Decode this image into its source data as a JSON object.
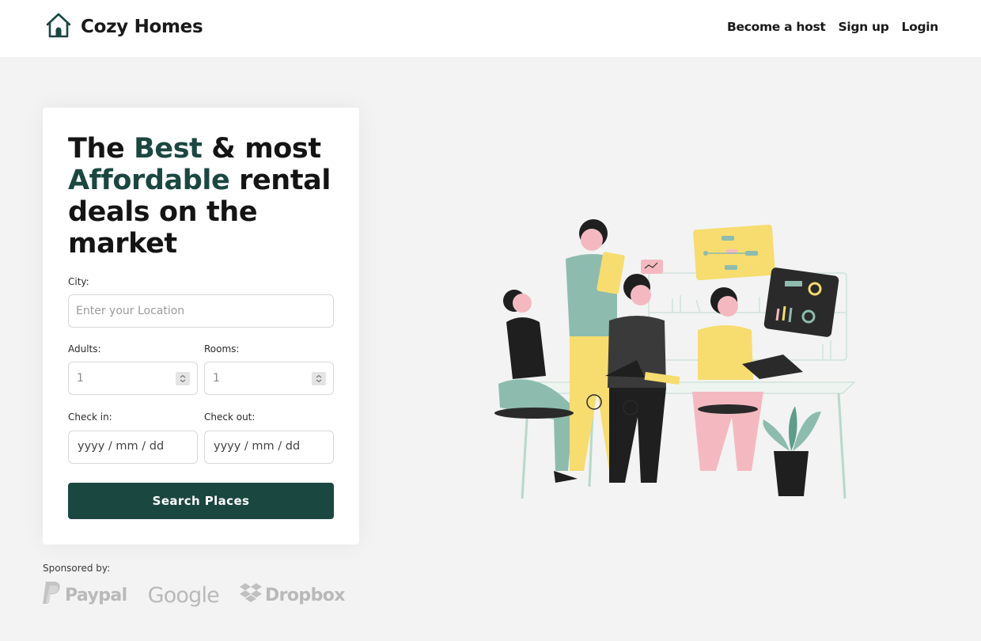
{
  "app": {
    "brand_name": "Cozy Homes",
    "brand_icon": "house-icon",
    "nav_links": [
      "Become a host",
      "Sign up",
      "Login"
    ]
  },
  "hero": {
    "headline": {
      "part1": "The ",
      "highlight1": "Best",
      "part2": " & most ",
      "highlight2": "Affordable",
      "part3": " rental deals on the market"
    }
  },
  "form": {
    "city_label": "City:",
    "city_placeholder": "Enter your Location",
    "adults_label": "Adults:",
    "adults_value": "1",
    "rooms_label": "Rooms:",
    "rooms_value": "1",
    "checkin_label": "Check in:",
    "checkin_placeholder": "yyyy / mm / dd",
    "checkout_label": "Check out:",
    "checkout_placeholder": "yyyy / mm / dd",
    "search_button": "Search Places"
  },
  "sponsors": {
    "label": "Sponsored by:",
    "items": [
      "Paypal",
      "Google",
      "Dropbox"
    ]
  },
  "colors": {
    "accent": "#1b4741",
    "background": "#f3f3f3",
    "illustration_teal": "#8dbcae",
    "illustration_yellow": "#f7dc6f",
    "illustration_pink": "#f4b9c0"
  }
}
